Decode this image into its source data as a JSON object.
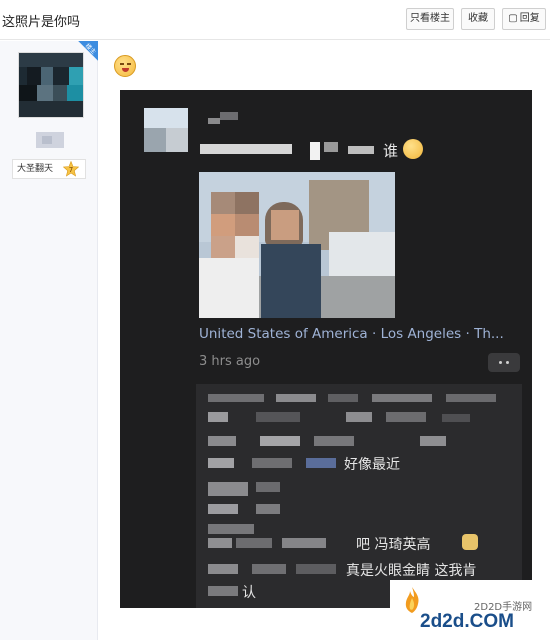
{
  "header": {
    "title": "这照片是你吗",
    "buttons": {
      "only_op": "只看楼主",
      "favorite": "收藏",
      "reply": "回复"
    }
  },
  "user": {
    "corner_badge": "楼主",
    "level_name": "大圣翻天",
    "level_number": "7"
  },
  "post": {
    "screenshot": {
      "question_suffix": "谁",
      "location": "United States of America · Los Angeles · Th...",
      "time": "3 hrs ago",
      "comments": {
        "c1": "好像最近",
        "c2": "吧 冯琦英高",
        "c3": "真是火眼金睛 这我肯",
        "c4": "认"
      }
    }
  },
  "watermark": {
    "small": "2D2D手游网",
    "big": "2d2d.COM"
  },
  "colors": {
    "link_blue": "#9fb3d6",
    "screenshot_bg": "#1e1e1f",
    "comment_bg": "#2b2b2d",
    "badge_blue": "#3d8de0"
  }
}
